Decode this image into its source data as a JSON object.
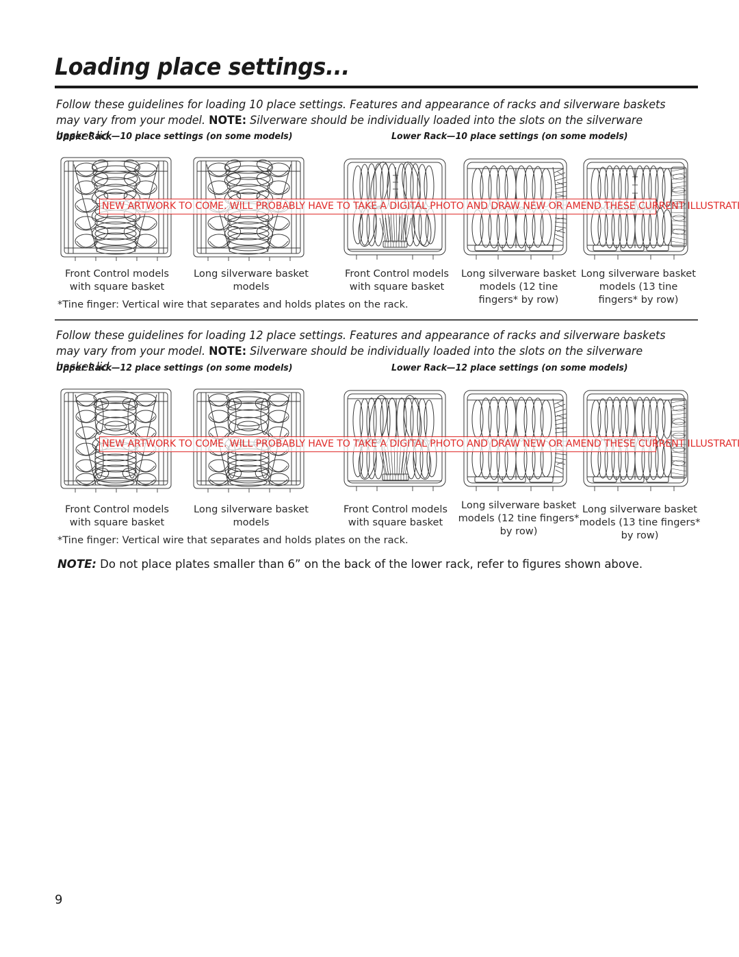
{
  "document": {
    "title": "Loading place settings...",
    "page_number": "9"
  },
  "sections": [
    {
      "id": "ten-place",
      "intro_part1": "Follow these guidelines for loading 10 place settings. Features and appearance of racks and silverware baskets may vary from your model. ",
      "intro_note_label": "NOTE:",
      "intro_part2": " Silverware should be individually loaded into the slots on the silverware basket lid.",
      "upper_label": "Upper Rack—10 place settings (on some models)",
      "lower_label": "Lower Rack—10 place settings (on some models)",
      "captions": [
        "Front Control models with square basket",
        "Long silverware basket models",
        "Front Control models with square basket",
        "Long silverware basket models (12 tine fingers* by row)",
        "Long silverware basket models (13 tine fingers* by row)"
      ],
      "footnote": "*Tine finger: Vertical wire that separates and holds plates on the rack."
    },
    {
      "id": "twelve-place",
      "intro_part1": "Follow these guidelines for loading 12 place settings. Features and appearance of racks and silverware baskets may vary from your model. ",
      "intro_note_label": "NOTE:",
      "intro_part2": " Silverware should be individually loaded into the slots on the silverware basket lid.",
      "upper_label": "Upper Rack—12 place settings (on some models)",
      "lower_label": "Lower Rack—12 place settings (on some models)",
      "captions": [
        "Front Control models with square basket",
        "Long silverware basket models",
        "Front Control models with square basket",
        "Long silverware basket models (12 tine fingers* by row)",
        "Long silverware basket models (13 tine fingers* by row)"
      ],
      "footnote": "*Tine finger: Vertical wire that separates and holds plates on the rack."
    }
  ],
  "bottom_note": {
    "label": "NOTE:",
    "text": " Do not place plates smaller than 6” on the back of the lower rack, refer to figures shown above."
  },
  "annotations": {
    "revision_markup": "NEW ARTWORK TO COME. WILL PROBABLY HAVE TO TAKE A DIGITAL PHOTO AND DRAW NEW OR AMEND THESE CURRENT ILLUSTRATIONS.",
    "markup_color": "#e02b29"
  },
  "colors": {
    "text": "#1a1a1a",
    "caption_text": "#2a2a2a",
    "rule": "#1a1a1a",
    "line_art": "#333333",
    "annotation": "#e02b29"
  }
}
